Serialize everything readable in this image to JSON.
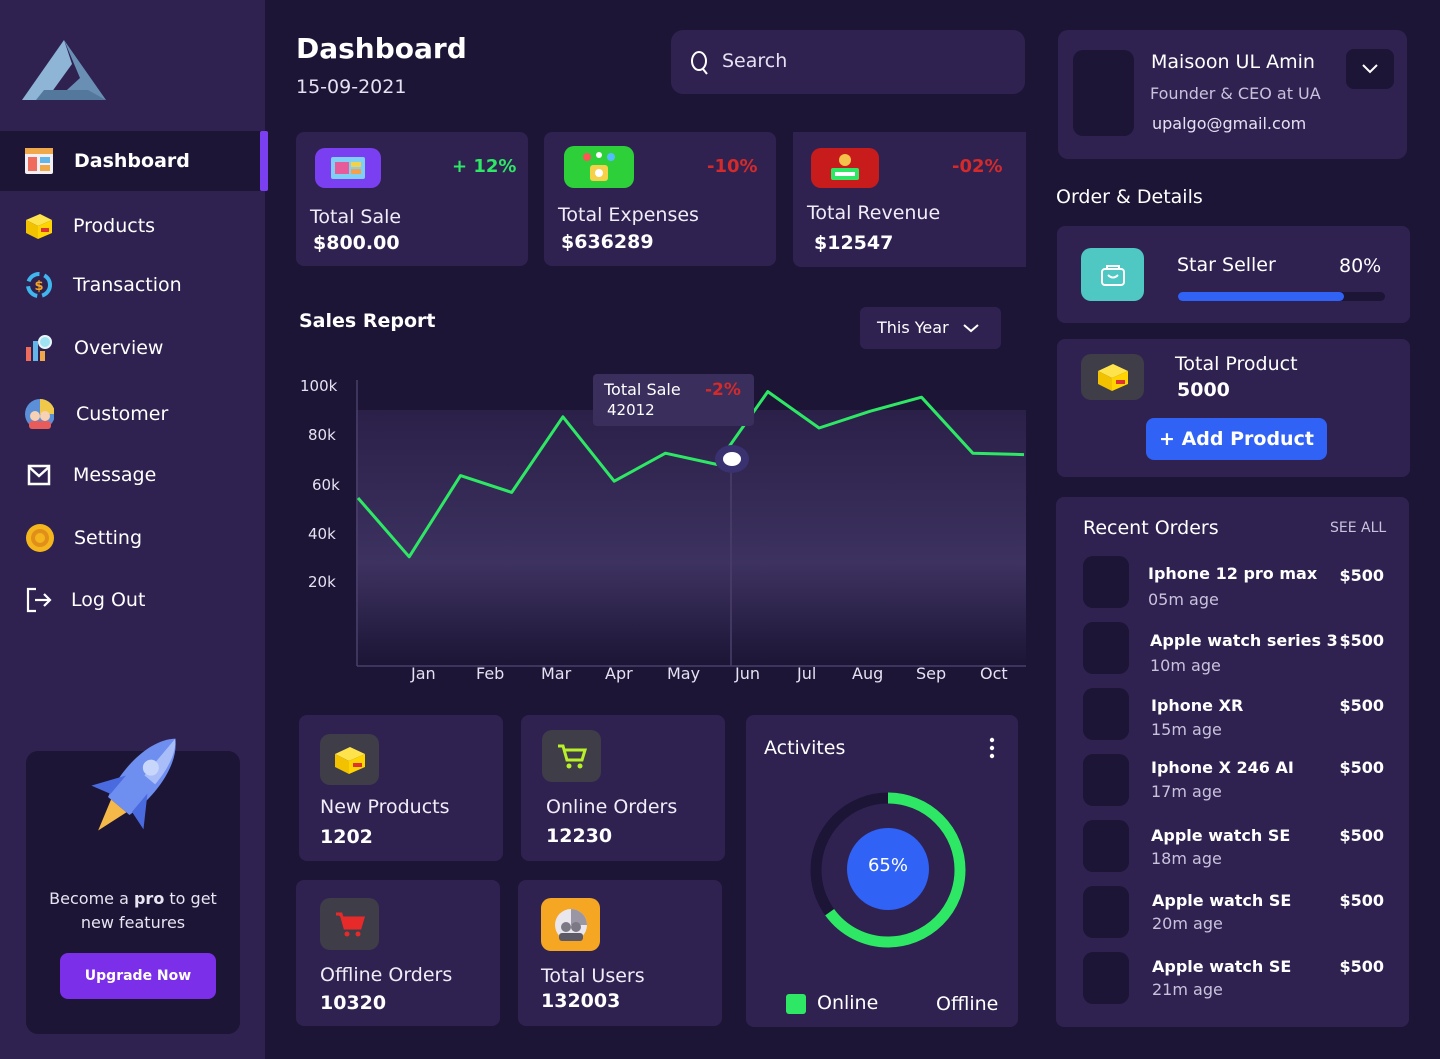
{
  "sidebar": {
    "items": [
      {
        "label": "Dashboard",
        "icon": "dashboard-icon"
      },
      {
        "label": "Products",
        "icon": "box-icon"
      },
      {
        "label": "Transaction",
        "icon": "transaction-icon"
      },
      {
        "label": "Overview",
        "icon": "chart-icon"
      },
      {
        "label": "Customer",
        "icon": "customers-icon"
      },
      {
        "label": "Message",
        "icon": "mail-icon"
      },
      {
        "label": "Setting",
        "icon": "gear-icon"
      },
      {
        "label": "Log Out",
        "icon": "logout-icon"
      }
    ],
    "promo": {
      "text_pre": "Become a ",
      "text_bold": "pro",
      "text_post": " to get",
      "text_line2": "new features",
      "button": "Upgrade Now"
    }
  },
  "header": {
    "title": "Dashboard",
    "date": "15-09-2021",
    "search_placeholder": "Search"
  },
  "stats": {
    "total_sale": {
      "label": "Total Sale",
      "value": "$800.00",
      "change": "+ 12%"
    },
    "total_expenses": {
      "label": "Total Expenses",
      "value": "$636289",
      "change": "-10%"
    },
    "total_revenue": {
      "label": "Total Revenue",
      "value": "$12547",
      "change": "-02%"
    }
  },
  "sales_report": {
    "title": "Sales Report",
    "period": "This Year",
    "tooltip": {
      "label": "Total Sale",
      "value": "42012",
      "change": "-2%"
    }
  },
  "chart_data": {
    "type": "line",
    "x": [
      "Jan",
      "Feb",
      "Mar",
      "Apr",
      "May",
      "Jun",
      "Jul",
      "Aug",
      "Sep",
      "Oct"
    ],
    "y_ticks": [
      "100k",
      "80k",
      "60k",
      "40k",
      "20k"
    ],
    "series": [
      {
        "points": [
          [
            "",
            60000
          ],
          [
            "",
            39000
          ],
          [
            "",
            68000
          ],
          [
            "",
            62000
          ],
          [
            "Mar",
            89000
          ],
          [
            "",
            66000
          ],
          [
            "",
            76000
          ],
          [
            "",
            72000
          ],
          [
            "Jun",
            98000
          ],
          [
            "",
            85000
          ],
          [
            "",
            91000
          ],
          [
            "Sep",
            96000
          ],
          [
            "",
            76000
          ],
          [
            "Oct",
            75500
          ]
        ]
      }
    ],
    "ylim": [
      0,
      100000
    ],
    "line_color": "#2ee865"
  },
  "bottom_stats": {
    "new_products": {
      "label": "New Products",
      "value": "1202"
    },
    "online_orders": {
      "label": "Online Orders",
      "value": "12230"
    },
    "offline_orders": {
      "label": "Offline Orders",
      "value": "10320"
    },
    "total_users": {
      "label": "Total Users",
      "value": "132003"
    }
  },
  "activities": {
    "title": "Activites",
    "percent_label": "65%",
    "online_fraction": 0.65,
    "legend_online": "Online",
    "legend_offline": "Offline"
  },
  "profile": {
    "name": "Maisoon UL Amin",
    "role": "Founder & CEO at UA",
    "email": "upalgo@gmail.com"
  },
  "order_details": {
    "title": "Order & Details",
    "star_seller_label": "Star Seller",
    "star_seller_percent": "80%",
    "star_seller_fraction": 0.8,
    "total_product_label": "Total Product",
    "total_product_value": "5000",
    "add_product_button": "+ Add Product"
  },
  "recent_orders": {
    "title": "Recent Orders",
    "see_all": "SEE ALL",
    "items": [
      {
        "name": "Iphone 12 pro max",
        "age": "05m age",
        "price": "$500"
      },
      {
        "name": "Apple watch series 3",
        "age": "10m age",
        "price": "$500"
      },
      {
        "name": "Iphone XR",
        "age": "15m age",
        "price": "$500"
      },
      {
        "name": "Iphone X 246 AI",
        "age": "17m age",
        "price": "$500"
      },
      {
        "name": "Apple watch SE",
        "age": "18m age",
        "price": "$500"
      },
      {
        "name": "Apple watch SE",
        "age": "20m age",
        "price": "$500"
      },
      {
        "name": "Apple watch SE",
        "age": "21m age",
        "price": "$500"
      }
    ]
  },
  "colors": {
    "background": "#1c1535",
    "card": "#2f2251",
    "accent": "#7b3ff2",
    "positive": "#2ee865",
    "negative": "#d42a2a",
    "button_blue": "#2f62f5"
  }
}
